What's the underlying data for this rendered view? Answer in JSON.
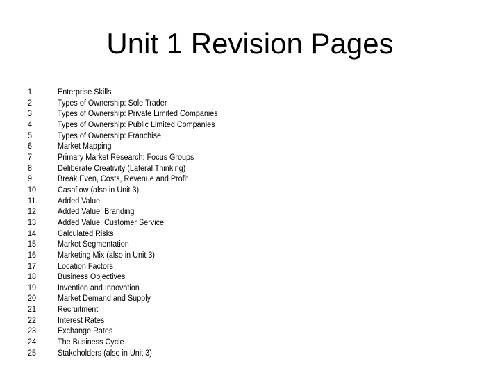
{
  "slide": {
    "title": "Unit 1 Revision Pages",
    "background_color": "#ffffff",
    "text_color": "#000000",
    "items": [
      {
        "number": "1.",
        "label": "Enterprise Skills"
      },
      {
        "number": "2.",
        "label": "Types of Ownership: Sole Trader"
      },
      {
        "number": "3.",
        "label": "Types of Ownership: Private Limited Companies"
      },
      {
        "number": "4.",
        "label": "Types of Ownership: Public Limited Companies"
      },
      {
        "number": "5.",
        "label": "Types of Ownership: Franchise"
      },
      {
        "number": "6.",
        "label": "Market Mapping"
      },
      {
        "number": "7.",
        "label": "Primary Market Research: Focus Groups"
      },
      {
        "number": "8.",
        "label": "Deliberate Creativity (Lateral Thinking)"
      },
      {
        "number": "9.",
        "label": "Break Even, Costs, Revenue and Profit"
      },
      {
        "number": "10.",
        "label": "Cashflow (also in Unit 3)"
      },
      {
        "number": "11.",
        "label": "Added Value"
      },
      {
        "number": "12.",
        "label": "Added Value: Branding"
      },
      {
        "number": "13.",
        "label": "Added Value: Customer Service"
      },
      {
        "number": "14.",
        "label": "Calculated Risks"
      },
      {
        "number": "15.",
        "label": "Market Segmentation"
      },
      {
        "number": "16.",
        "label": "Marketing Mix (also in Unit 3)"
      },
      {
        "number": "17.",
        "label": "Location Factors"
      },
      {
        "number": "18.",
        "label": "Business Objectives"
      },
      {
        "number": "19.",
        "label": "Invention and Innovation"
      },
      {
        "number": "20.",
        "label": "Market Demand and Supply"
      },
      {
        "number": "21.",
        "label": "Recruitment"
      },
      {
        "number": "22.",
        "label": "Interest Rates"
      },
      {
        "number": "23.",
        "label": "Exchange Rates"
      },
      {
        "number": "24.",
        "label": "The Business Cycle"
      },
      {
        "number": "25.",
        "label": "Stakeholders (also in Unit 3)"
      }
    ]
  }
}
